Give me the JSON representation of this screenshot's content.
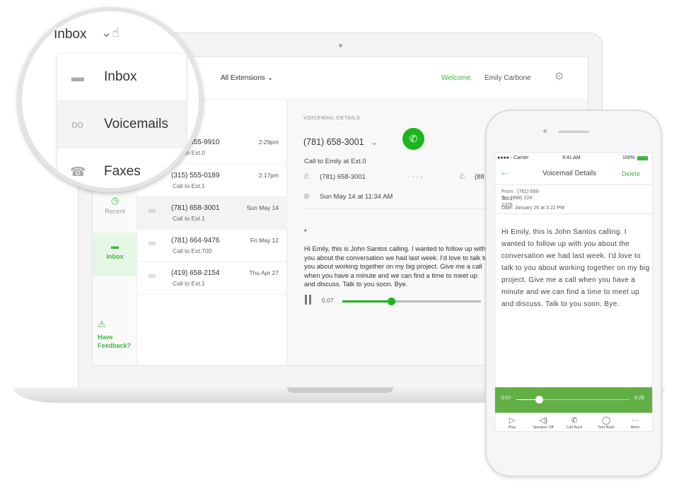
{
  "header": {
    "extension_filter": "All Extensions",
    "welcome": "Welcome,",
    "user": "Emily Carbone"
  },
  "magnifier": {
    "title": "Inbox",
    "items": [
      {
        "label": "Inbox",
        "icon": "inbox-icon"
      },
      {
        "label": "Voicemails",
        "icon": "voicemail-icon"
      },
      {
        "label": "Faxes",
        "icon": "fax-icon"
      }
    ]
  },
  "nav": {
    "recent": "Recent",
    "inbox": "Inbox",
    "feedback_line1": "Have",
    "feedback_line2": "Feedback?"
  },
  "list": [
    {
      "number": "(781) 555-9910",
      "sub": "Call to Ext.0",
      "date": "2:29pm"
    },
    {
      "number": "(315) 555-0189",
      "sub": "Call to Ext.1",
      "date": "2:17pm"
    },
    {
      "number": "(781) 658-3001",
      "sub": "Call to Ext.1",
      "date": "Sun May 14",
      "selected": true
    },
    {
      "number": "(781) 664-9476",
      "sub": "Call to Ext.700",
      "date": "Fri May 12"
    },
    {
      "number": "(419) 658-2154",
      "sub": "Call to Ext.1",
      "date": "Thu Apr 27"
    }
  ],
  "detail": {
    "heading": "VOICEMAIL DETAILS",
    "number": "(781) 658-3001",
    "call_to": "Call to Emily at Ext.0",
    "from": "(781) 658-3001",
    "to": "(88",
    "date": "Sun May 14 at 11:34 AM",
    "transcript": "Hi Emily, this is John Santos calling. I wanted to follow up with you about the conversation we had last week. I'd love to talk to you about working together on my big project. Give me a call when you have a minute and we can find a time to meet up and discuss. Talk to you soon. Bye.",
    "time": "0.07",
    "progress": 0.35,
    "accent": "#1db51d"
  },
  "phone": {
    "carrier": "●●●●○ Carrier",
    "clock": "9:41 AM",
    "battery": "100%",
    "title": "Voicemail Details",
    "delete": "Delete",
    "from": "From : (781) 658-3001",
    "to": "To : (888) 224-1376",
    "date": "Date: January 26 at 3:22 PM",
    "transcript": "Hi Emily, this is John Santos calling. I wanted to follow up with you about the conversation we had last week. I'd love to talk to you about working together on my big project. Give me a call when you have a minute and we can find a time to meet up and discuss. Talk to you soon. Bye.",
    "elapsed": "0:07",
    "remaining": "-0:29",
    "progress": 0.2,
    "player_color": "#62b045",
    "tabs": [
      "Play",
      "Speaker Off",
      "Call Back",
      "Text Back",
      "More"
    ]
  }
}
